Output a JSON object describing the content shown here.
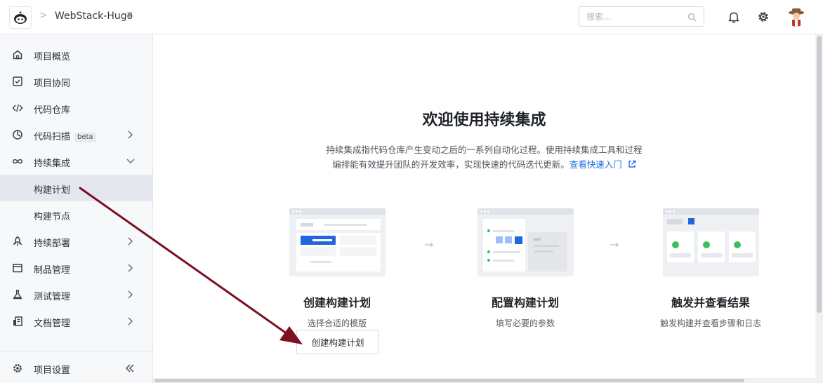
{
  "header": {
    "project_name": "WebStack-Hugo",
    "search_placeholder": "搜索..."
  },
  "sidebar": {
    "items": [
      {
        "label": "项目概览",
        "icon": "home-icon"
      },
      {
        "label": "项目协同",
        "icon": "check-square-icon"
      },
      {
        "label": "代码仓库",
        "icon": "code-icon"
      },
      {
        "label": "代码扫描",
        "icon": "scan-icon",
        "badge": "beta"
      },
      {
        "label": "持续集成",
        "icon": "infinity-icon",
        "expanded": true
      },
      {
        "label": "构建计划",
        "sub": true,
        "active": true
      },
      {
        "label": "构建节点",
        "sub": true
      },
      {
        "label": "持续部署",
        "icon": "rocket-icon"
      },
      {
        "label": "制品管理",
        "icon": "box-icon"
      },
      {
        "label": "测试管理",
        "icon": "flask-icon"
      },
      {
        "label": "文档管理",
        "icon": "document-icon"
      }
    ],
    "settings_label": "项目设置"
  },
  "main": {
    "title": "欢迎使用持续集成",
    "desc_line1": "持续集成指代码仓库产生变动之后的一系列自动化过程。使用持续集成工具和过程",
    "desc_line2": "编排能有效提升团队的开发效率，实现快速的代码迭代更新。",
    "quick_start_link": "查看快速入门",
    "steps": [
      {
        "title": "创建构建计划",
        "subtitle": "选择合适的模版"
      },
      {
        "title": "配置构建计划",
        "subtitle": "填写必要的参数"
      },
      {
        "title": "触发并查看结果",
        "subtitle": "触发构建并查看步骤和日志"
      }
    ],
    "create_button": "创建构建计划",
    "step_arrow": "→"
  },
  "colors": {
    "accent": "#1f6ee3",
    "annotation_arrow": "#7a1020",
    "success": "#3fbd5d"
  }
}
